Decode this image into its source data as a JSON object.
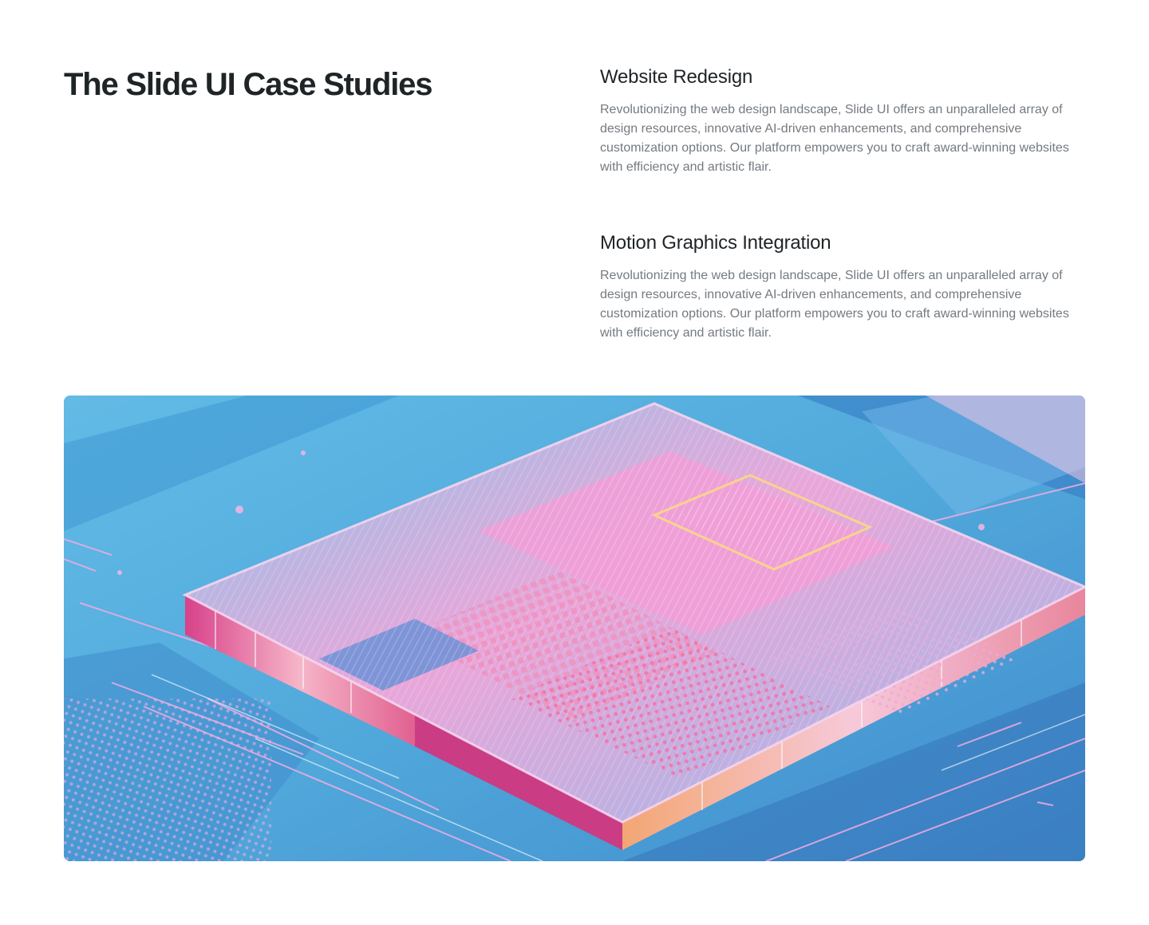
{
  "page": {
    "title": "The Slide UI Case Studies"
  },
  "case_studies": [
    {
      "heading": "Website Redesign",
      "body": "Revolutionizing the web design landscape, Slide UI offers an unparalleled array of design resources, innovative AI-driven enhancements, and comprehensive customization options. Our platform empowers you to craft award-winning websites with efficiency and artistic flair."
    },
    {
      "heading": "Motion Graphics Integration",
      "body": "Revolutionizing the web design landscape, Slide UI offers an unparalleled array of design resources, innovative AI-driven enhancements, and comprehensive customization options. Our platform empowers you to craft award-winning websites with efficiency and artistic flair."
    }
  ],
  "hero_image": {
    "subject": "isometric-glass-microchip-illustration",
    "colors": {
      "background_blue": "#4aa8da",
      "deep_blue": "#2f6fb8",
      "pink": "#f29ad6",
      "magenta": "#d23a8a",
      "orange": "#f5a66a"
    }
  }
}
